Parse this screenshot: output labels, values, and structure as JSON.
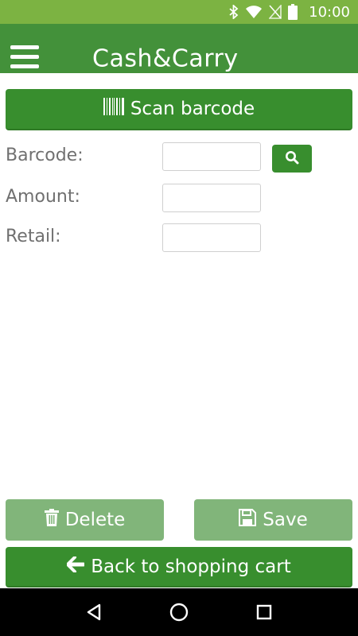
{
  "status_bar": {
    "time": "10:00",
    "icons": [
      "bluetooth-icon",
      "wifi-icon",
      "no-sim-icon",
      "battery-icon"
    ]
  },
  "app_bar": {
    "title": "Cash&Carry",
    "menu_icon": "hamburger-menu-icon",
    "background": "#43913a"
  },
  "scan_button": {
    "label": "Scan barcode",
    "icon": "barcode-icon"
  },
  "form": {
    "barcode": {
      "label": "Barcode:",
      "value": "",
      "placeholder": ""
    },
    "amount": {
      "label": "Amount:",
      "value": "",
      "placeholder": ""
    },
    "retail": {
      "label": "Retail:",
      "value": "",
      "placeholder": ""
    },
    "search_icon": "search-icon"
  },
  "actions": {
    "delete_label": "Delete",
    "delete_icon": "trash-icon",
    "save_label": "Save",
    "save_icon": "floppy-disk-icon",
    "back_label": "Back to shopping cart",
    "back_icon": "arrow-left-icon"
  },
  "nav_bar": {
    "items": [
      "back-triangle-icon",
      "home-circle-icon",
      "recents-square-icon"
    ]
  },
  "colors": {
    "status_bar": "#7cb342",
    "primary_green": "#388e2e",
    "disabled_green": "#81b57a",
    "label_gray": "#707070"
  }
}
